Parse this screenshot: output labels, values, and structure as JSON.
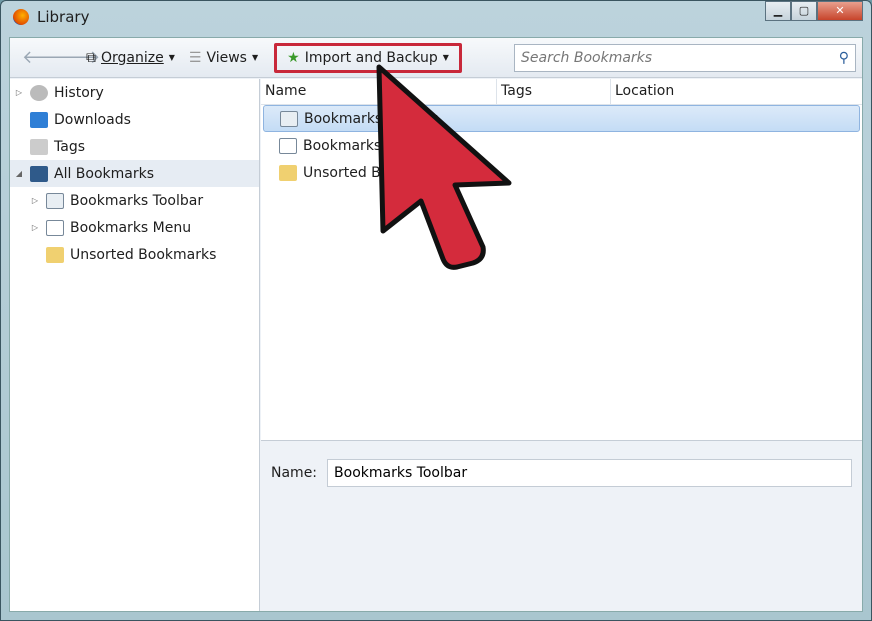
{
  "window": {
    "title": "Library"
  },
  "toolbar": {
    "organize": "Organize",
    "views": "Views",
    "import_backup": "Import and Backup",
    "search_placeholder": "Search Bookmarks"
  },
  "sidebar": {
    "items": [
      {
        "label": "History",
        "icon": "history-icon"
      },
      {
        "label": "Downloads",
        "icon": "download-icon"
      },
      {
        "label": "Tags",
        "icon": "tag-icon"
      },
      {
        "label": "All Bookmarks",
        "icon": "star-icon"
      },
      {
        "label": "Bookmarks Toolbar",
        "icon": "toolbar-icon"
      },
      {
        "label": "Bookmarks Menu",
        "icon": "menu-icon"
      },
      {
        "label": "Unsorted Bookmarks",
        "icon": "unsorted-icon"
      }
    ]
  },
  "list": {
    "columns": [
      "Name",
      "Tags",
      "Location"
    ],
    "rows": [
      {
        "name": "Bookmarks Toolbar"
      },
      {
        "name": "Bookmarks Menu"
      },
      {
        "name": "Unsorted Bookmarks"
      }
    ]
  },
  "details": {
    "name_label": "Name:",
    "name_value": "Bookmarks Toolbar"
  },
  "colors": {
    "highlight": "#c8283a",
    "arrow": "#d42b3c"
  }
}
